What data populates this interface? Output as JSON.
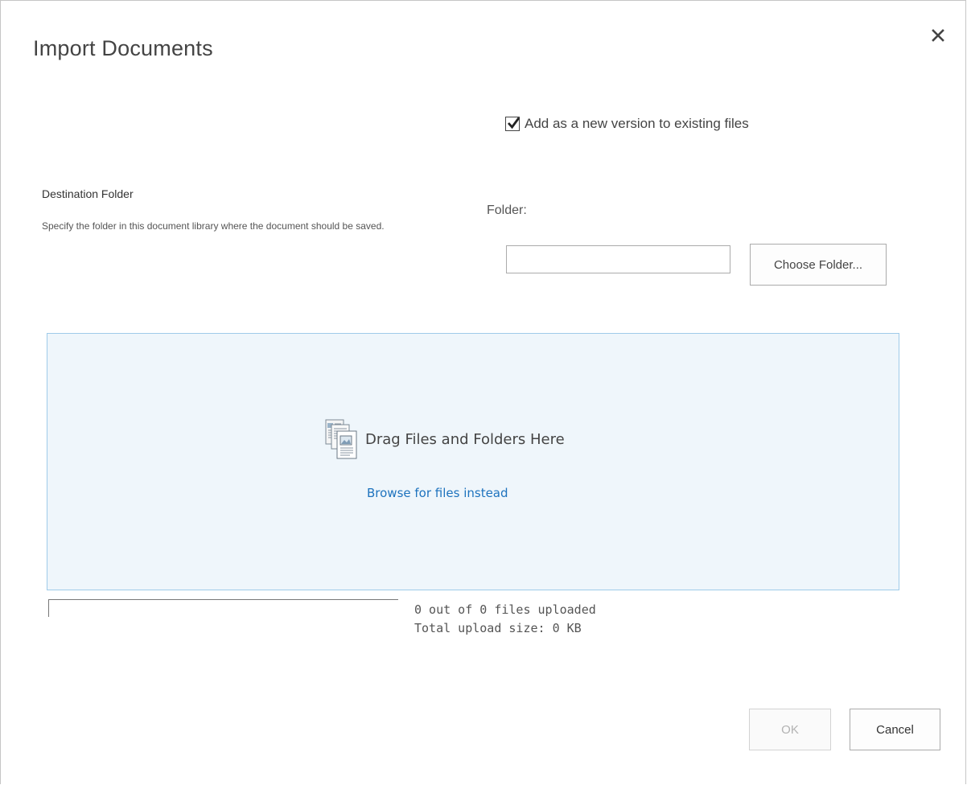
{
  "dialog": {
    "title": "Import Documents",
    "close_icon": "close-icon"
  },
  "options": {
    "add_version_label": "Add as a new version to existing files",
    "add_version_checked": true
  },
  "destination": {
    "heading": "Destination Folder",
    "description": "Specify the folder in this document library where the document should be saved.",
    "folder_label": "Folder:",
    "folder_value": "",
    "choose_folder_label": "Choose Folder..."
  },
  "drop_zone": {
    "icon": "documents-icon",
    "text": "Drag Files and Folders Here",
    "browse_link": "Browse for files instead",
    "background_color": "#eff6fb",
    "border_color": "#9fcbe9"
  },
  "upload": {
    "progress_fraction": 0,
    "files_status": "0 out of 0 files uploaded",
    "size_status": "Total upload size: 0 KB"
  },
  "footer": {
    "ok_label": "OK",
    "ok_enabled": false,
    "cancel_label": "Cancel"
  },
  "colors": {
    "link": "#1e73be",
    "text": "#444444"
  }
}
